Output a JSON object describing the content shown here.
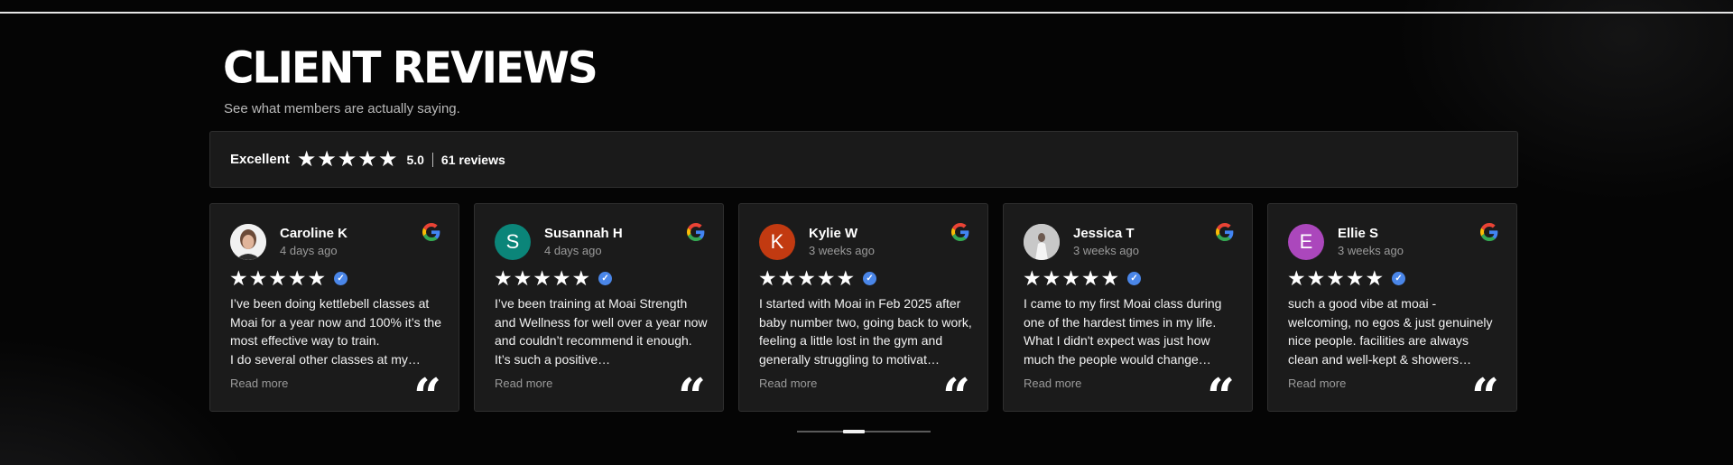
{
  "header": {
    "title": "CLIENT REVIEWS",
    "subtitle": "See what members are actually saying."
  },
  "summary": {
    "label": "Excellent",
    "rating": 5,
    "score": "5.0",
    "count": "61 reviews"
  },
  "colors": {
    "verified": "#4a86e8",
    "google_blue": "#4285F4",
    "google_red": "#EA4335",
    "google_yellow": "#FBBC05",
    "google_green": "#34A853"
  },
  "reviews": [
    {
      "name": "Caroline K",
      "time": "4 days ago",
      "avatar_type": "photo",
      "avatar_initial": "",
      "avatar_color": "#d9d9d9",
      "text": "I’ve been doing kettlebell classes at Moai for a year now and 100% it’s the most effective way to train.\nI do several other classes at my…",
      "read_more": "Read more"
    },
    {
      "name": "Susannah H",
      "time": "4 days ago",
      "avatar_type": "initial",
      "avatar_initial": "S",
      "avatar_color": "#0b8579",
      "text": "I’ve been training at Moai Strength and Wellness for well over a year now and couldn’t recommend it enough. It’s such a positive…",
      "read_more": "Read more"
    },
    {
      "name": "Kylie W",
      "time": "3 weeks ago",
      "avatar_type": "initial",
      "avatar_initial": "K",
      "avatar_color": "#c23a11",
      "text": "I started with Moai in Feb 2025 after baby number two, going back to work, feeling a little lost in the gym and generally struggling to motivat…",
      "read_more": "Read more"
    },
    {
      "name": "Jessica T",
      "time": "3 weeks ago",
      "avatar_type": "photo",
      "avatar_initial": "",
      "avatar_color": "#cfcfcf",
      "text": "I came to my first Moai class during one of the hardest times in my life. What I didn't expect was just how much the people would change…",
      "read_more": "Read more"
    },
    {
      "name": "Ellie S",
      "time": "3 weeks ago",
      "avatar_type": "initial",
      "avatar_initial": "E",
      "avatar_color": "#ab47bc",
      "text": "such a good vibe at moai - welcoming, no egos & just genuinely nice people. facilities are always clean and well-kept & showers…",
      "read_more": "Read more"
    }
  ],
  "icons": {
    "star": "★",
    "quote": "“",
    "verified": "✓"
  },
  "pager": {
    "page": 2,
    "pages": 5
  }
}
